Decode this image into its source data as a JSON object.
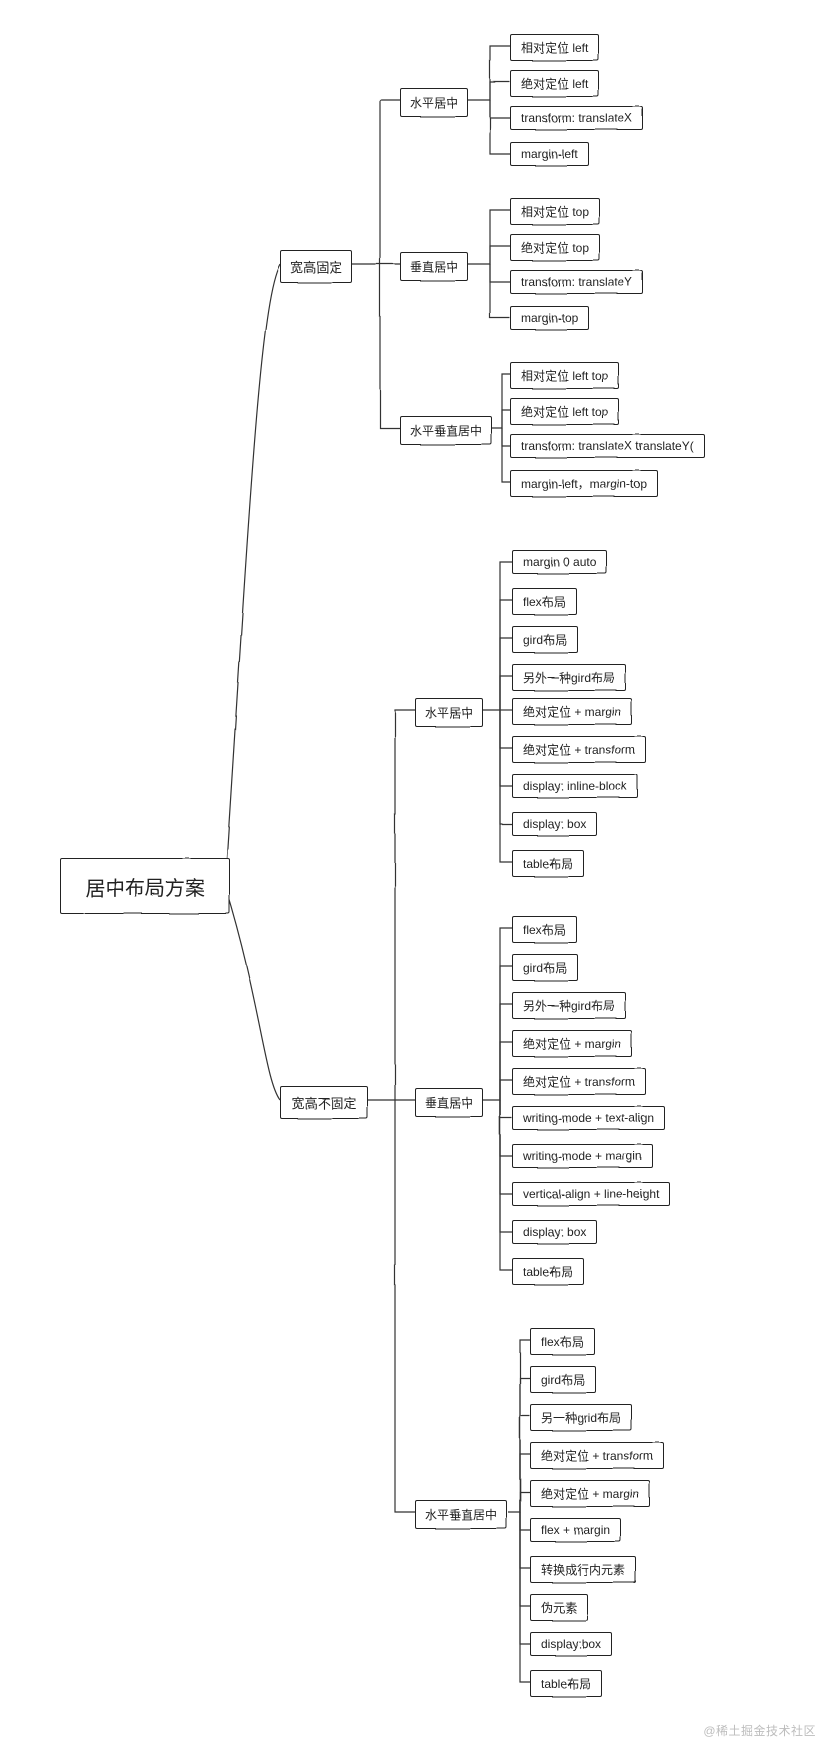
{
  "root": {
    "label": "居中布局方案"
  },
  "fixed": {
    "label": "宽高固定",
    "h": {
      "label": "水平居中",
      "items": [
        "相对定位 left",
        "绝对定位 left",
        "transform: translateX",
        "margin-left"
      ]
    },
    "v": {
      "label": "垂直居中",
      "items": [
        "相对定位 top",
        "绝对定位 top",
        "transform: translateY",
        "margin-top"
      ]
    },
    "hv": {
      "label": "水平垂直居中",
      "items": [
        "相对定位 left top",
        "绝对定位 left top",
        "transform: translateX translateY(",
        "margin-left，margin-top"
      ]
    }
  },
  "unfixed": {
    "label": "宽高不固定",
    "h": {
      "label": "水平居中",
      "items": [
        "margin 0 auto",
        "flex布局",
        "gird布局",
        "另外一种gird布局",
        "绝对定位 + margin",
        "绝对定位 + transform",
        "display: inline-block",
        "display: box",
        "table布局"
      ]
    },
    "v": {
      "label": "垂直居中",
      "items": [
        "flex布局",
        "gird布局",
        "另外一种gird布局",
        "绝对定位 + margin",
        "绝对定位 + transform",
        "writing-mode + text-align",
        "writing-mode + margin",
        "vertical-align + line-height",
        "display: box",
        "table布局"
      ]
    },
    "hv": {
      "label": "水平垂直居中",
      "items": [
        "flex布局",
        "gird布局",
        "另一种grid布局",
        "绝对定位 + transform",
        "绝对定位 + margin",
        "flex + margin",
        "转换成行内元素",
        "伪元素",
        "display:box",
        "table布局"
      ]
    }
  },
  "watermark": "@稀土掘金技术社区"
}
